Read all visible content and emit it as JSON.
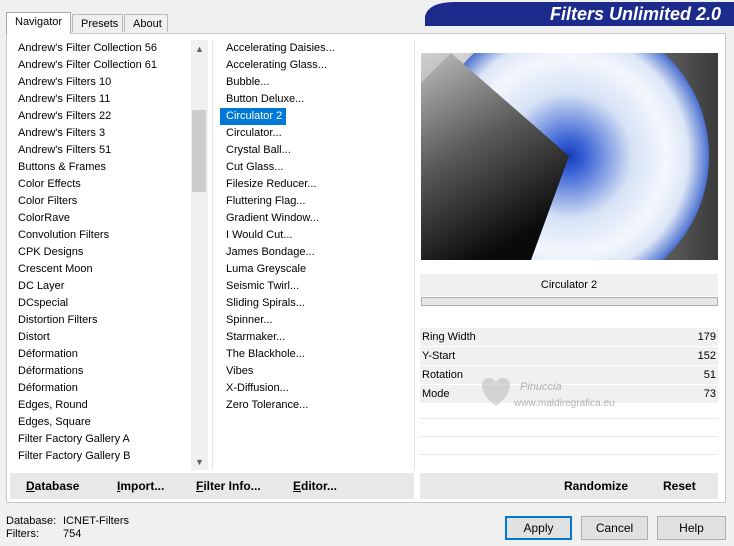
{
  "tabs": [
    "Navigator",
    "Presets",
    "About"
  ],
  "banner_title": "Filters Unlimited 2.0",
  "categories": [
    "Andrew's Filter Collection 56",
    "Andrew's Filter Collection 61",
    "Andrew's Filters 10",
    "Andrew's Filters 11",
    "Andrew's Filters 22",
    "Andrew's Filters 3",
    "Andrew's Filters 51",
    "Buttons & Frames",
    "Color Effects",
    "Color Filters",
    "ColorRave",
    "Convolution Filters",
    "CPK Designs",
    "Crescent Moon",
    "DC Layer",
    "DCspecial",
    "Distortion Filters",
    "Distort",
    "Déformation",
    "Déformations",
    "Déformation",
    "Edges, Round",
    "Edges, Square",
    "Filter Factory Gallery A",
    "Filter Factory Gallery B"
  ],
  "filters": [
    "Accelerating Daisies...",
    "Accelerating Glass...",
    "Bubble...",
    "Button Deluxe...",
    "Circulator 2",
    "Circulator...",
    "Crystal Ball...",
    "Cut Glass...",
    "Filesize Reducer...",
    "Fluttering Flag...",
    "Gradient Window...",
    "I Would Cut...",
    "James Bondage...",
    "Luma Greyscale",
    "Seismic Twirl...",
    "Sliding Spirals...",
    "Spinner...",
    "Starmaker...",
    "The Blackhole...",
    "Vibes",
    "X-Diffusion...",
    "Zero Tolerance..."
  ],
  "selected_filter": "Circulator 2",
  "params": [
    {
      "name": "Ring Width",
      "value": "179"
    },
    {
      "name": "Y-Start",
      "value": "152"
    },
    {
      "name": "Rotation",
      "value": "51"
    },
    {
      "name": "Mode",
      "value": "73"
    }
  ],
  "bottom_buttons": {
    "database": {
      "first": "D",
      "rest": "atabase"
    },
    "import": {
      "first": "I",
      "rest": "mport..."
    },
    "filter_info": {
      "first": "F",
      "rest": "ilter Info..."
    },
    "editor": {
      "first": "E",
      "rest": "ditor..."
    },
    "randomize": "Randomize",
    "reset": "Reset"
  },
  "status": {
    "db_label": "Database:",
    "db_value": "ICNET-Filters",
    "filters_label": "Filters:",
    "filters_value": "754"
  },
  "dialog": {
    "apply": "Apply",
    "cancel": "Cancel",
    "help": "Help"
  },
  "watermark": {
    "text": "Pinuccia",
    "url": "www.maldiregrafica.eu"
  },
  "colors": {
    "accent_blue": "#0078d7",
    "banner_navy": "#1d2b8c",
    "preview_blue": "#2a4fc0"
  }
}
